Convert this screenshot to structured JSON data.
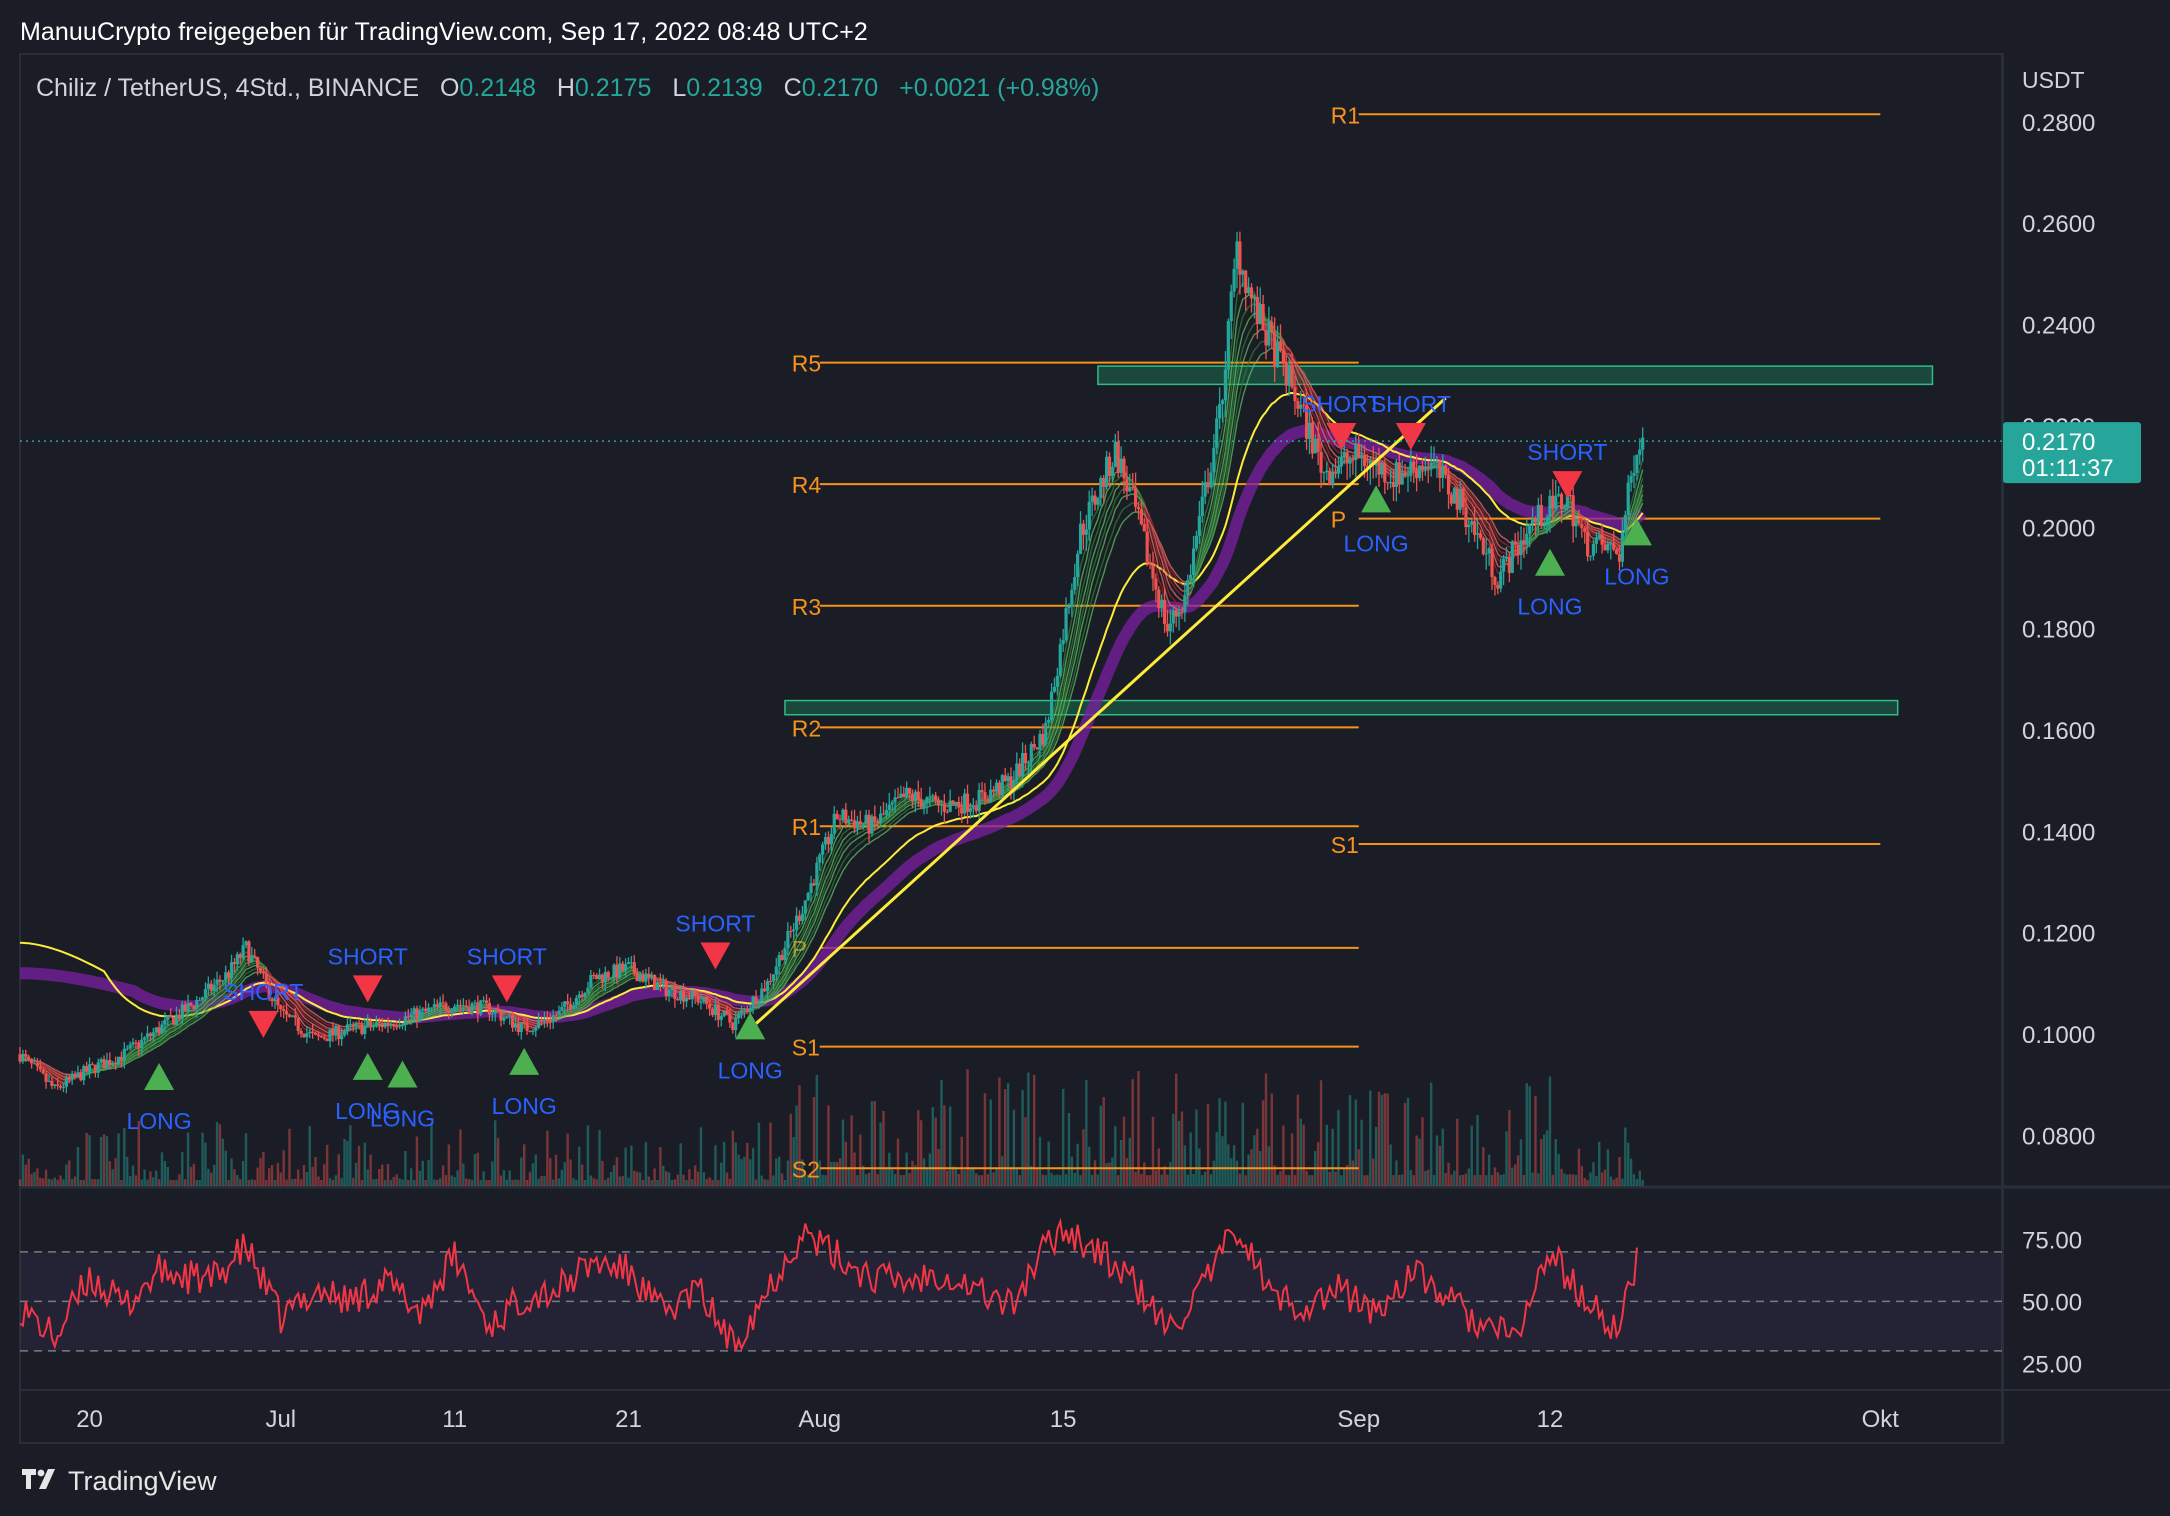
{
  "header": {
    "share_text": "ManuuCrypto freigegeben für TradingView.com, Sep 17, 2022 08:48 UTC+2"
  },
  "legend": {
    "symbol": "Chiliz / TetherUS, 4Std., BINANCE",
    "open_label": "O",
    "open": "0.2148",
    "high_label": "H",
    "high": "0.2175",
    "low_label": "L",
    "low": "0.2139",
    "close_label": "C",
    "close": "0.2170",
    "change": "+0.0021 (+0.98%)"
  },
  "price_axis": {
    "unit": "USDT",
    "ticks": [
      "0.2800",
      "0.2600",
      "0.2400",
      "0.2200",
      "0.2000",
      "0.1800",
      "0.1600",
      "0.1400",
      "0.1200",
      "0.1000",
      "0.0800"
    ],
    "current_price": "0.2170",
    "countdown": "01:11:37"
  },
  "rsi_axis": {
    "ticks": [
      "75.00",
      "50.00",
      "25.00"
    ]
  },
  "time_axis": {
    "labels": [
      "20",
      "Jul",
      "11",
      "21",
      "Aug",
      "15",
      "Sep",
      "12",
      "Okt"
    ]
  },
  "colors": {
    "background": "#1a1d26",
    "up": "#26a69a",
    "down": "#ef5350",
    "pivot": "#f7931a",
    "trendline": "#ffeb3b",
    "ma_purple": "#7b1fa2",
    "long_signal": "#4caf50",
    "short_signal": "#f23645",
    "signal_text": "#2962ff",
    "rsi_line": "#f23645"
  },
  "chart_data": {
    "type": "candlestick",
    "title": "Chiliz / TetherUS, 4Std., BINANCE",
    "ylabel": "USDT",
    "ylim": [
      0.07,
      0.293
    ],
    "x_range": [
      "2022-06-16",
      "2022-10-08"
    ],
    "x_ticks": [
      "20",
      "Jul",
      "11",
      "21",
      "Aug",
      "15",
      "Sep",
      "12",
      "Okt"
    ],
    "grid": false,
    "price_path": [
      [
        "2022-06-16",
        0.096
      ],
      [
        "2022-06-18",
        0.089
      ],
      [
        "2022-06-20",
        0.093
      ],
      [
        "2022-06-22",
        0.096
      ],
      [
        "2022-06-24",
        0.101
      ],
      [
        "2022-06-26",
        0.106
      ],
      [
        "2022-06-28",
        0.112
      ],
      [
        "2022-06-29",
        0.117
      ],
      [
        "2022-07-01",
        0.104
      ],
      [
        "2022-07-03",
        0.099
      ],
      [
        "2022-07-05",
        0.101
      ],
      [
        "2022-07-07",
        0.102
      ],
      [
        "2022-07-09",
        0.104
      ],
      [
        "2022-07-11",
        0.106
      ],
      [
        "2022-07-13",
        0.105
      ],
      [
        "2022-07-15",
        0.101
      ],
      [
        "2022-07-17",
        0.104
      ],
      [
        "2022-07-19",
        0.111
      ],
      [
        "2022-07-21",
        0.113
      ],
      [
        "2022-07-23",
        0.109
      ],
      [
        "2022-07-25",
        0.107
      ],
      [
        "2022-07-27",
        0.102
      ],
      [
        "2022-07-29",
        0.11
      ],
      [
        "2022-07-31",
        0.125
      ],
      [
        "2022-08-02",
        0.143
      ],
      [
        "2022-08-04",
        0.141
      ],
      [
        "2022-08-06",
        0.147
      ],
      [
        "2022-08-08",
        0.145
      ],
      [
        "2022-08-10",
        0.146
      ],
      [
        "2022-08-12",
        0.15
      ],
      [
        "2022-08-14",
        0.16
      ],
      [
        "2022-08-16",
        0.199
      ],
      [
        "2022-08-18",
        0.215
      ],
      [
        "2022-08-19",
        0.205
      ],
      [
        "2022-08-21",
        0.18
      ],
      [
        "2022-08-22",
        0.186
      ],
      [
        "2022-08-24",
        0.222
      ],
      [
        "2022-08-25",
        0.255
      ],
      [
        "2022-08-26",
        0.243
      ],
      [
        "2022-08-28",
        0.229
      ],
      [
        "2022-08-30",
        0.211
      ],
      [
        "2022-09-01",
        0.214
      ],
      [
        "2022-09-03",
        0.21
      ],
      [
        "2022-09-05",
        0.213
      ],
      [
        "2022-09-07",
        0.204
      ],
      [
        "2022-09-09",
        0.19
      ],
      [
        "2022-09-11",
        0.201
      ],
      [
        "2022-09-13",
        0.206
      ],
      [
        "2022-09-14",
        0.197
      ],
      [
        "2022-09-16",
        0.195
      ],
      [
        "2022-09-17",
        0.217
      ]
    ],
    "pivot_sets": [
      {
        "from": "2022-08-01",
        "to": "2022-09-01",
        "levels": [
          {
            "label": "R5",
            "value": 0.2325
          },
          {
            "label": "R4",
            "value": 0.2085
          },
          {
            "label": "R3",
            "value": 0.1845
          },
          {
            "label": "R2",
            "value": 0.1605
          },
          {
            "label": "R1",
            "value": 0.141
          },
          {
            "label": "P",
            "value": 0.117
          },
          {
            "label": "S1",
            "value": 0.0975
          },
          {
            "label": "S2",
            "value": 0.0735
          }
        ]
      },
      {
        "from": "2022-09-01",
        "to": "2022-10-01",
        "levels": [
          {
            "label": "R1",
            "value": 0.2815
          },
          {
            "label": "P",
            "value": 0.2017
          },
          {
            "label": "S1",
            "value": 0.1375
          }
        ]
      }
    ],
    "zones": [
      {
        "from": "2022-08-17",
        "to": "2022-10-04",
        "top": 0.2318,
        "bottom": 0.2282
      },
      {
        "from": "2022-07-30",
        "to": "2022-10-02",
        "top": 0.1658,
        "bottom": 0.163
      }
    ],
    "trendline": [
      [
        "2022-07-28",
        0.101
      ],
      [
        "2022-09-06",
        0.2255
      ]
    ],
    "signals": [
      {
        "type": "LONG",
        "date": "2022-06-24",
        "price": 0.0915
      },
      {
        "type": "SHORT",
        "date": "2022-06-30",
        "price": 0.102
      },
      {
        "type": "SHORT",
        "date": "2022-07-06",
        "price": 0.109
      },
      {
        "type": "LONG",
        "date": "2022-07-06",
        "price": 0.0935
      },
      {
        "type": "LONG",
        "date": "2022-07-08",
        "price": 0.092
      },
      {
        "type": "SHORT",
        "date": "2022-07-14",
        "price": 0.109
      },
      {
        "type": "LONG",
        "date": "2022-07-15",
        "price": 0.0945
      },
      {
        "type": "SHORT",
        "date": "2022-07-26",
        "price": 0.1155
      },
      {
        "type": "LONG",
        "date": "2022-07-28",
        "price": 0.1015
      },
      {
        "type": "SHORT",
        "date": "2022-08-31",
        "price": 0.218
      },
      {
        "type": "LONG",
        "date": "2022-09-02",
        "price": 0.2055
      },
      {
        "type": "SHORT",
        "date": "2022-09-04",
        "price": 0.218
      },
      {
        "type": "LONG",
        "date": "2022-09-12",
        "price": 0.193
      },
      {
        "type": "SHORT",
        "date": "2022-09-13",
        "price": 0.2085
      },
      {
        "type": "LONG",
        "date": "2022-09-17",
        "price": 0.199
      }
    ],
    "rsi": {
      "ylim": [
        15,
        95
      ],
      "band": [
        30,
        70
      ],
      "midline": 50,
      "path": [
        [
          "2022-06-16",
          48
        ],
        [
          "2022-06-18",
          35
        ],
        [
          "2022-06-20",
          60
        ],
        [
          "2022-06-22",
          48
        ],
        [
          "2022-06-24",
          62
        ],
        [
          "2022-06-27",
          58
        ],
        [
          "2022-06-29",
          72
        ],
        [
          "2022-07-01",
          43
        ],
        [
          "2022-07-03",
          55
        ],
        [
          "2022-07-05",
          50
        ],
        [
          "2022-07-07",
          58
        ],
        [
          "2022-07-09",
          46
        ],
        [
          "2022-07-11",
          68
        ],
        [
          "2022-07-13",
          40
        ],
        [
          "2022-07-15",
          52
        ],
        [
          "2022-07-17",
          55
        ],
        [
          "2022-07-19",
          66
        ],
        [
          "2022-07-21",
          62
        ],
        [
          "2022-07-23",
          45
        ],
        [
          "2022-07-25",
          55
        ],
        [
          "2022-07-27",
          32
        ],
        [
          "2022-07-29",
          55
        ],
        [
          "2022-07-31",
          78
        ],
        [
          "2022-08-02",
          68
        ],
        [
          "2022-08-04",
          60
        ],
        [
          "2022-08-06",
          58
        ],
        [
          "2022-08-08",
          62
        ],
        [
          "2022-08-10",
          55
        ],
        [
          "2022-08-12",
          48
        ],
        [
          "2022-08-14",
          72
        ],
        [
          "2022-08-15",
          80
        ],
        [
          "2022-08-17",
          70
        ],
        [
          "2022-08-19",
          58
        ],
        [
          "2022-08-21",
          38
        ],
        [
          "2022-08-23",
          55
        ],
        [
          "2022-08-25",
          80
        ],
        [
          "2022-08-27",
          52
        ],
        [
          "2022-08-29",
          48
        ],
        [
          "2022-08-31",
          55
        ],
        [
          "2022-09-02",
          45
        ],
        [
          "2022-09-04",
          62
        ],
        [
          "2022-09-06",
          52
        ],
        [
          "2022-09-08",
          40
        ],
        [
          "2022-09-10",
          35
        ],
        [
          "2022-09-12",
          70
        ],
        [
          "2022-09-14",
          50
        ],
        [
          "2022-09-16",
          38
        ],
        [
          "2022-09-17",
          68
        ]
      ]
    }
  }
}
